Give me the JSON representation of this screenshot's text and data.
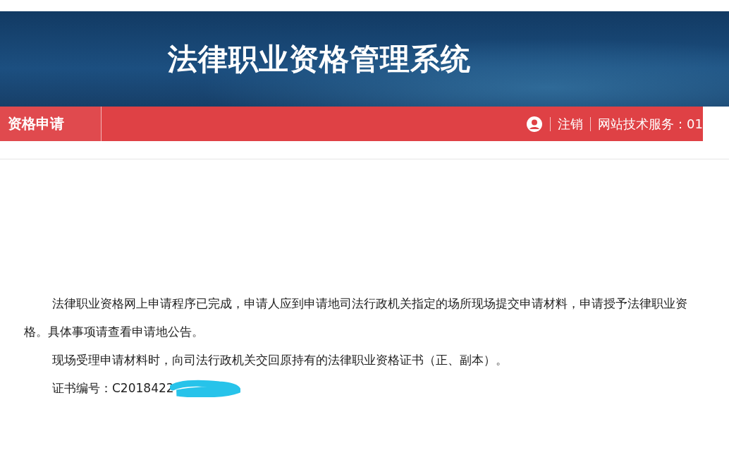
{
  "header": {
    "title": "法律职业资格管理系统"
  },
  "navbar": {
    "tab": {
      "label": "资格申请",
      "selected": true
    },
    "links": [
      {
        "label": "注销"
      },
      {
        "label": "网站技术服务：01"
      }
    ]
  },
  "content": {
    "paragraphs": [
      "法律职业资格网上申请程序已完成，申请人应到申请地司法行政机关指定的场所现场提交申请材料，申请授予法律职业资格。具体事项请查看申请地公告。",
      "现场受理申请材料时，向司法行政机关交回原持有的法律职业资格证书（正、副本）。"
    ],
    "certificate": {
      "label": "证书编号：",
      "number": "C2018422",
      "redacted": true
    }
  }
}
